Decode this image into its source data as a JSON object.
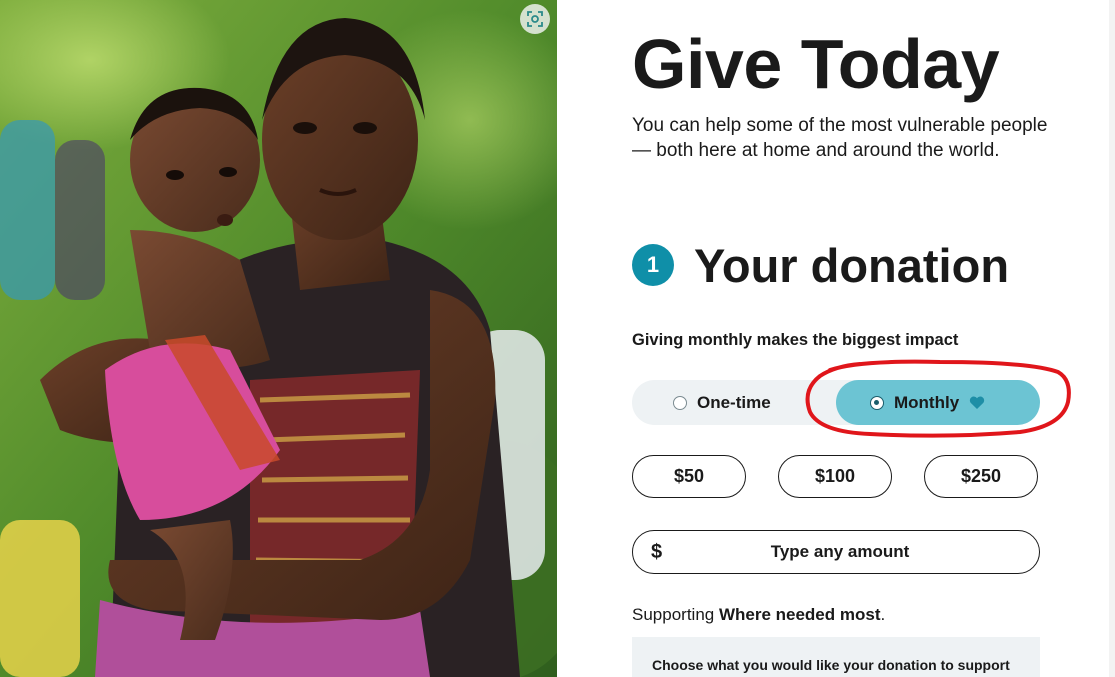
{
  "photo": {
    "alt_icon": "image-search-icon"
  },
  "header": {
    "title": "Give Today",
    "subtitle": "You can help some of the most vulnerable people — both here at home and around the world."
  },
  "donation_step": {
    "number": "1",
    "title": "Your donation",
    "impact_text": "Giving monthly makes the biggest impact"
  },
  "frequency": {
    "options": [
      {
        "label": "One-time",
        "selected": false
      },
      {
        "label": "Monthly",
        "selected": true,
        "icon": "heart-icon"
      }
    ]
  },
  "amounts": {
    "options": [
      "$50",
      "$100",
      "$250"
    ],
    "currency_symbol": "$",
    "custom_placeholder": "Type any amount"
  },
  "supporting": {
    "prefix": "Supporting ",
    "value": "Where needed most",
    "suffix": "."
  },
  "designation": {
    "label": "Choose what you would like your donation to support"
  },
  "colors": {
    "accent_teal": "#0f8fa8",
    "selected_option_bg": "#6cc4d3",
    "toggle_bg": "#eef2f4",
    "annotation_red": "#e0161b",
    "text": "#1a1a1a"
  }
}
